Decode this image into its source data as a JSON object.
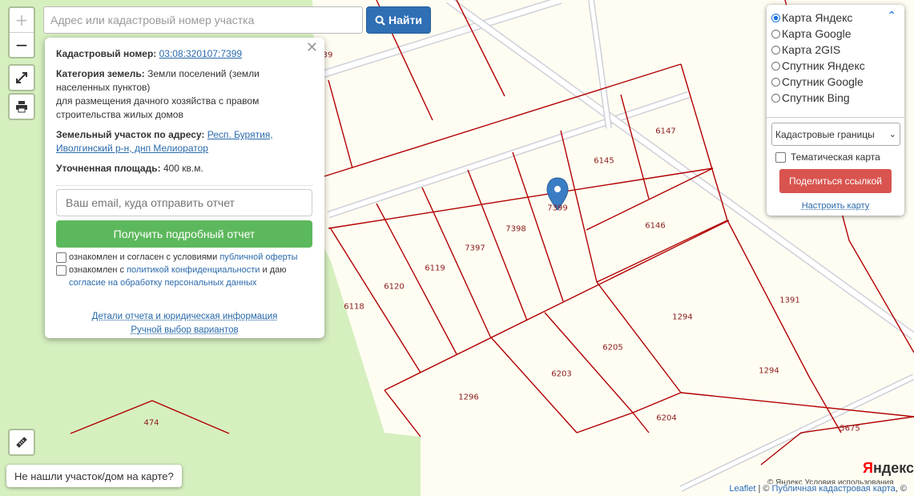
{
  "search": {
    "placeholder": "Адрес или кадастровый номер участка",
    "button_label": "Найти"
  },
  "zoom": {
    "in_label": "+",
    "out_label": "−"
  },
  "popup": {
    "cadastral_label": "Кадастровый номер:",
    "cadastral_number": "03:08:320107:7399",
    "category_label": "Категория земель:",
    "category_value": "Земли поселений (земли населенных пунктов)",
    "usage_value": "для размещения дачного хозяйства с правом строительства жилых домов",
    "address_label": "Земельный участок по адресу:",
    "address_value": "Респ. Бурятия, Иволгинский р-н, днп Мелиоратор",
    "area_label": "Уточненная площадь:",
    "area_value": "400 кв.м.",
    "email_placeholder": "Ваш email, куда отправить отчет",
    "report_button": "Получить подробный отчет",
    "offer_text": "ознакомлен и согласен с условиями",
    "offer_link": "публичной оферты",
    "privacy_text_1": "ознакомлен с",
    "privacy_link": "политикой конфиденциальности",
    "privacy_text_2": "и даю",
    "consent_link": "согласие на обработку персональных данных",
    "details_link": "Детали отчета и юридическая информация",
    "manual_link": "Ручной выбор вариантов"
  },
  "layers": {
    "options": [
      {
        "label": "Карта Яндекс",
        "selected": true
      },
      {
        "label": "Карта Google",
        "selected": false
      },
      {
        "label": "Карта 2GIS",
        "selected": false
      },
      {
        "label": "Спутник Яндекс",
        "selected": false
      },
      {
        "label": "Спутник Google",
        "selected": false
      },
      {
        "label": "Спутник Bing",
        "selected": false
      }
    ],
    "overlay_select": "Кадастровые границы",
    "thematic_label": "Тематическая карта",
    "share_button": "Поделиться ссылкой",
    "configure_link": "Настроить карту"
  },
  "not_found_button": "Не нашли участок/дом на карте?",
  "attribution": {
    "leaflet": "Leaflet",
    "separator": "| ©",
    "pkk": "Публичная кадастровая карта",
    "suffix": ", ©"
  },
  "yandex": {
    "logo_first": "Я",
    "logo_rest": "ндекс",
    "copyright": "© Яндекс Условия использования"
  },
  "map_labels": {
    "p474": "474",
    "p6118": "6118",
    "p6120": "6120",
    "p6119": "6119",
    "p7397": "7397",
    "p7398": "7398",
    "p7399": "7399",
    "p6145": "6145",
    "p6147": "6147",
    "p6146": "6146",
    "p1294a": "1294",
    "p1294b": "1294",
    "p1391": "1391",
    "p1296": "1296",
    "p6203": "6203",
    "p6205": "6205",
    "p6204": "6204",
    "p5675": "5675",
    "p39": "39"
  },
  "colors": {
    "boundary": "#b10000",
    "green_area": "#d6efbf",
    "map_bg": "#fffdf2",
    "search_button": "#2f6fb4",
    "report_button": "#5cb85c",
    "share_button": "#d9534f"
  }
}
